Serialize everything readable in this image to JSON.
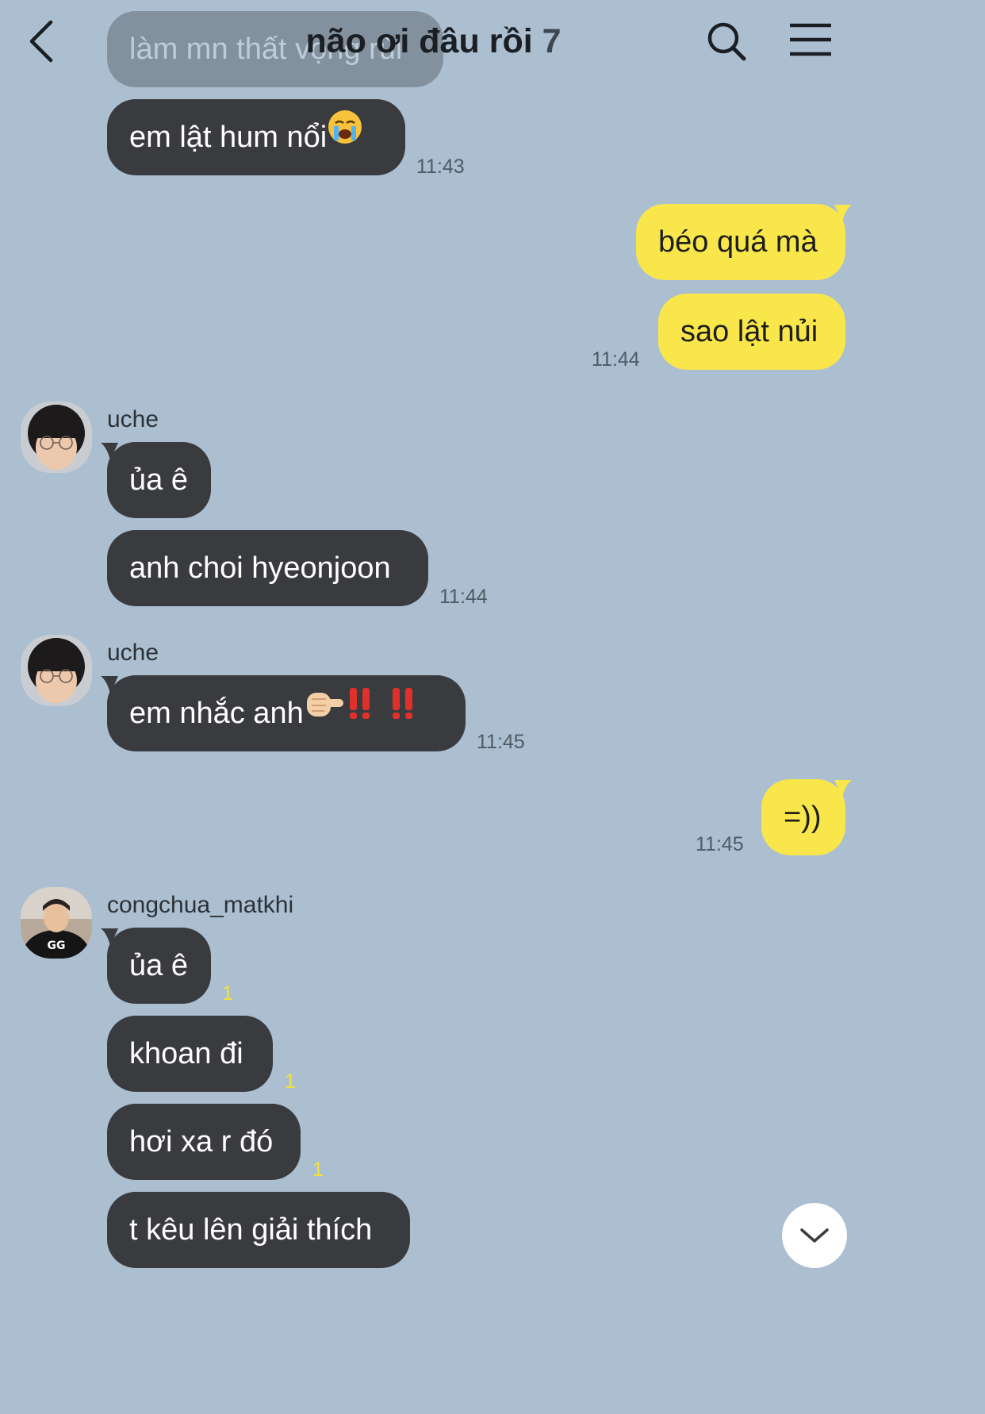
{
  "header": {
    "title": "não ơi đâu rồi",
    "member_count": "7",
    "back_icon": "chevron-left-icon",
    "search_icon": "search-icon",
    "menu_icon": "hamburger-menu-icon"
  },
  "messages": {
    "m0": {
      "text": "làm mn thất vọng rùi"
    },
    "m1": {
      "text": "em lật hum nổi",
      "emoji": "loudly-crying-face",
      "time": "11:43"
    },
    "m2": {
      "text": "béo quá mà"
    },
    "m3": {
      "text": "sao lật nủi",
      "time": "11:44"
    },
    "s1": {
      "name": "uche"
    },
    "m4": {
      "text": "ủa ê"
    },
    "m5": {
      "text": "anh choi hyeonjoon",
      "time": "11:44"
    },
    "s2": {
      "name": "uche"
    },
    "m6": {
      "text": "em nhắc anh",
      "emoji": "pointing-finger double-exclamation",
      "time": "11:45"
    },
    "m7": {
      "text": "=))",
      "time": "11:45"
    },
    "s3": {
      "name": "congchua_matkhi"
    },
    "m8": {
      "text": "ủa ê",
      "unread": "1"
    },
    "m9": {
      "text": "khoan đi",
      "unread": "1"
    },
    "m10": {
      "text": "hơi xa r đó",
      "unread": "1"
    },
    "m11": {
      "text": "t kêu lên giải thích"
    }
  },
  "scroll_down_icon": "chevron-down-icon",
  "colors": {
    "background": "#abbfd1",
    "incoming_bubble": "#3a3b3f",
    "outgoing_bubble": "#f8e64b",
    "unread_count": "#f5e13a"
  }
}
